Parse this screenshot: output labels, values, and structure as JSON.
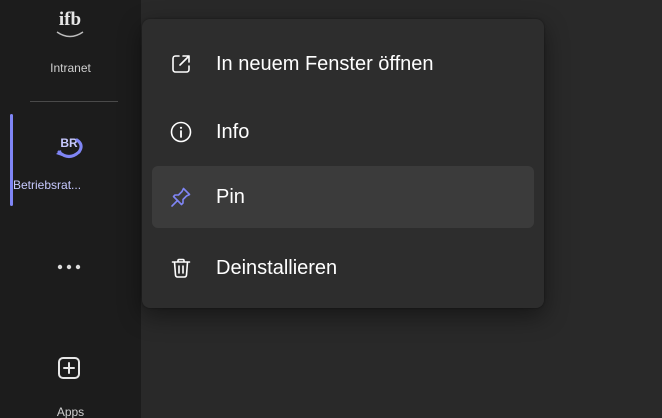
{
  "colors": {
    "rail_background": "#1c1c1c",
    "content_background": "#292929",
    "menu_background": "#2d2d2d",
    "hover_background": "#3b3b3b",
    "accent": "#7f85f5",
    "text": "#ffffff"
  },
  "rail": {
    "items": [
      {
        "label": "Intranet",
        "icon": "ifb-logo-icon",
        "icon_text": "ifb"
      },
      {
        "label": "Betriebsrat...",
        "icon": "betriebsrat-icon",
        "icon_text": "BR",
        "active": true
      },
      {
        "icon": "more-options-icon"
      },
      {
        "label": "Apps",
        "icon": "apps-add-icon"
      }
    ]
  },
  "context_menu": {
    "items": [
      {
        "label": "In neuem Fenster öffnen",
        "icon": "open-in-new-window-icon"
      },
      {
        "label": "Info",
        "icon": "info-icon"
      },
      {
        "label": "Pin",
        "icon": "pin-icon",
        "hovered": true
      },
      {
        "label": "Deinstallieren",
        "icon": "trash-icon"
      }
    ]
  }
}
